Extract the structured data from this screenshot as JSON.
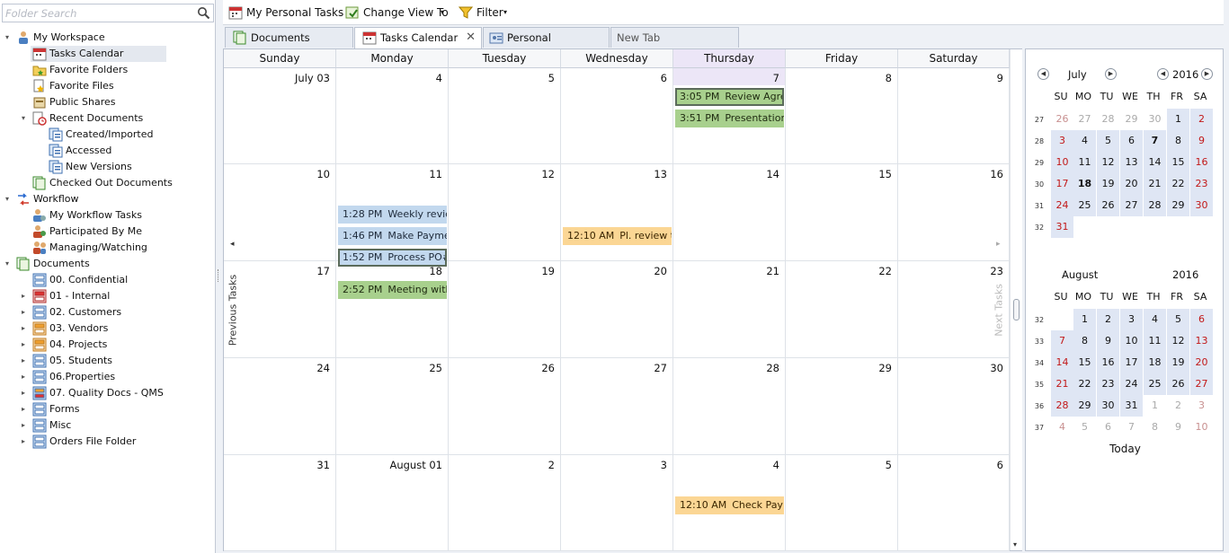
{
  "search": {
    "placeholder": "Folder Search",
    "icon": "search-icon"
  },
  "tree": [
    {
      "label": "My Workspace",
      "level": 0,
      "expand": "▾",
      "icon": "workspace"
    },
    {
      "label": "Tasks Calendar",
      "level": 1,
      "expand": "",
      "icon": "calendar",
      "selected": true
    },
    {
      "label": "Favorite Folders",
      "level": 1,
      "expand": "",
      "icon": "fav-folder"
    },
    {
      "label": "Favorite Files",
      "level": 1,
      "expand": "",
      "icon": "fav-file"
    },
    {
      "label": "Public Shares",
      "level": 1,
      "expand": "",
      "icon": "share"
    },
    {
      "label": "Recent Documents",
      "level": 1,
      "expand": "▾",
      "icon": "recent"
    },
    {
      "label": "Created/Imported",
      "level": 2,
      "expand": "",
      "icon": "doc-blue"
    },
    {
      "label": "Accessed",
      "level": 2,
      "expand": "",
      "icon": "doc-blue"
    },
    {
      "label": "New Versions",
      "level": 2,
      "expand": "",
      "icon": "doc-blue"
    },
    {
      "label": "Checked Out Documents",
      "level": 1,
      "expand": "",
      "icon": "checkout"
    },
    {
      "label": "Workflow",
      "level": 0,
      "expand": "▾",
      "icon": "workflow"
    },
    {
      "label": "My Workflow Tasks",
      "level": 1,
      "expand": "",
      "icon": "wf-tasks"
    },
    {
      "label": "Participated By Me",
      "level": 1,
      "expand": "",
      "icon": "wf-part"
    },
    {
      "label": "Managing/Watching",
      "level": 1,
      "expand": "",
      "icon": "wf-watch"
    },
    {
      "label": "Documents",
      "level": 0,
      "expand": "▾",
      "icon": "documents"
    },
    {
      "label": "00. Confidential",
      "level": 1,
      "expand": "",
      "icon": "cab-blue"
    },
    {
      "label": "01 - Internal",
      "level": 1,
      "expand": "▸",
      "icon": "cab-red"
    },
    {
      "label": "02. Customers",
      "level": 1,
      "expand": "▸",
      "icon": "cab-blue"
    },
    {
      "label": "03. Vendors",
      "level": 1,
      "expand": "▸",
      "icon": "cab-orange"
    },
    {
      "label": "04. Projects",
      "level": 1,
      "expand": "▸",
      "icon": "cab-orange"
    },
    {
      "label": "05. Students",
      "level": 1,
      "expand": "▸",
      "icon": "cab-blue"
    },
    {
      "label": "06.Properties",
      "level": 1,
      "expand": "▸",
      "icon": "cab-blue"
    },
    {
      "label": "07. Quality Docs - QMS",
      "level": 1,
      "expand": "▸",
      "icon": "cab-mixed"
    },
    {
      "label": "Forms",
      "level": 1,
      "expand": "▸",
      "icon": "cab-blue"
    },
    {
      "label": "Misc",
      "level": 1,
      "expand": "▸",
      "icon": "cab-blue"
    },
    {
      "label": "Orders File Folder",
      "level": 1,
      "expand": "▸",
      "icon": "cab-blue"
    }
  ],
  "toolbar": {
    "my_tasks": "My Personal Tasks",
    "change_view": "Change View To",
    "filter": "Filter"
  },
  "tabs": [
    {
      "label": "Documents",
      "icon": "documents-tab-icon",
      "active": false
    },
    {
      "label": "Tasks Calendar",
      "icon": "calendar-tab-icon",
      "active": true,
      "closable": true
    },
    {
      "label": "Personal",
      "icon": "personal-tab-icon",
      "active": false
    },
    {
      "label": "New Tab",
      "icon": "",
      "active": false
    }
  ],
  "calendar": {
    "weekdays": [
      "Sunday",
      "Monday",
      "Tuesday",
      "Wednesday",
      "Thursday",
      "Friday",
      "Saturday"
    ],
    "weeks": [
      [
        "July 03",
        "4",
        "5",
        "6",
        "7",
        "8",
        "9"
      ],
      [
        "10",
        "11",
        "12",
        "13",
        "14",
        "15",
        "16"
      ],
      [
        "17",
        "18",
        "19",
        "20",
        "21",
        "22",
        "23"
      ],
      [
        "24",
        "25",
        "26",
        "27",
        "28",
        "29",
        "30"
      ],
      [
        "31",
        "August 01",
        "2",
        "3",
        "4",
        "5",
        "6"
      ]
    ],
    "events": [
      {
        "week": 0,
        "day": 4,
        "slot": 0,
        "time": "3:05 PM",
        "name": "Review Agree",
        "color": "green",
        "selected": true
      },
      {
        "week": 0,
        "day": 4,
        "slot": 1,
        "time": "3:51 PM",
        "name": "Presentation",
        "color": "green",
        "selected": false
      },
      {
        "week": 1,
        "day": 1,
        "slot": 1,
        "time": "1:28 PM",
        "name": "Weekly review",
        "color": "blue",
        "selected": false
      },
      {
        "week": 1,
        "day": 1,
        "slot": 2,
        "time": "1:46 PM",
        "name": "Make Payment",
        "color": "blue",
        "selected": false
      },
      {
        "week": 1,
        "day": 1,
        "slot": 3,
        "time": "1:52 PM",
        "name": "Process PO#",
        "color": "blue",
        "selected": true
      },
      {
        "week": 1,
        "day": 3,
        "slot": 2,
        "time": "12:10 AM",
        "name": "Pl. review this",
        "color": "orange",
        "selected": false
      },
      {
        "week": 2,
        "day": 1,
        "slot": 0,
        "time": "2:52 PM",
        "name": "Meeting with",
        "color": "green",
        "selected": false
      },
      {
        "week": 4,
        "day": 4,
        "slot": 1,
        "time": "12:10 AM",
        "name": "Check Payment",
        "color": "orange",
        "selected": false
      }
    ],
    "prev_label": "Previous Tasks",
    "next_label": "Next Tasks"
  },
  "mini": {
    "weekdays": [
      "SU",
      "MO",
      "TU",
      "WE",
      "TH",
      "FR",
      "SA"
    ],
    "july": {
      "month": "July",
      "year": "2016",
      "weeks": [
        "27",
        "28",
        "29",
        "30",
        "31",
        "32"
      ],
      "days": [
        [
          "26",
          "27",
          "28",
          "29",
          "30",
          "1",
          "2"
        ],
        [
          "3",
          "4",
          "5",
          "6",
          "7",
          "8",
          "9"
        ],
        [
          "10",
          "11",
          "12",
          "13",
          "14",
          "15",
          "16"
        ],
        [
          "17",
          "18",
          "19",
          "20",
          "21",
          "22",
          "23"
        ],
        [
          "24",
          "25",
          "26",
          "27",
          "28",
          "29",
          "30"
        ],
        [
          "31",
          "",
          "",
          "",
          "",
          "",
          ""
        ]
      ]
    },
    "august": {
      "month": "August",
      "year": "2016",
      "weeks": [
        "32",
        "33",
        "34",
        "35",
        "36",
        "37"
      ],
      "days": [
        [
          "",
          "1",
          "2",
          "3",
          "4",
          "5",
          "6"
        ],
        [
          "7",
          "8",
          "9",
          "10",
          "11",
          "12",
          "13"
        ],
        [
          "14",
          "15",
          "16",
          "17",
          "18",
          "19",
          "20"
        ],
        [
          "21",
          "22",
          "23",
          "24",
          "25",
          "26",
          "27"
        ],
        [
          "28",
          "29",
          "30",
          "31",
          "1",
          "2",
          "3"
        ],
        [
          "4",
          "5",
          "6",
          "7",
          "8",
          "9",
          "10"
        ]
      ]
    },
    "today_label": "Today"
  },
  "colors": {
    "event_blue": "#c2d8ee",
    "event_green": "#a8d08d",
    "event_orange": "#fbd694",
    "weekend_red": "#c21818",
    "highlight": "#dfe6f4"
  }
}
